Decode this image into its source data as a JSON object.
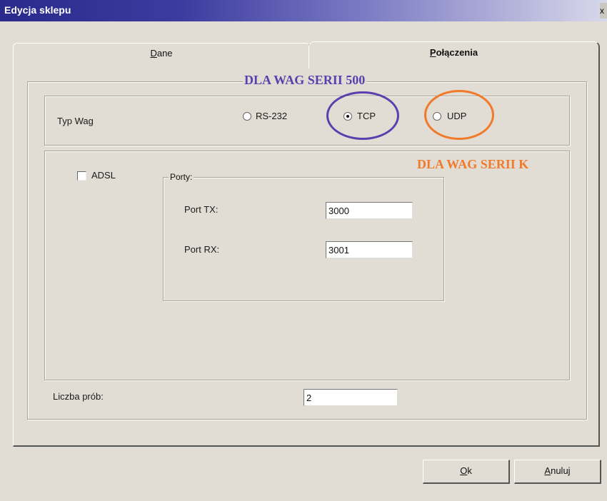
{
  "window": {
    "title": "Edycja sklepu",
    "close_glyph": "x"
  },
  "tabs": [
    {
      "label_first": "D",
      "label_rest": "ane",
      "active": false
    },
    {
      "label_first": "P",
      "label_rest": "ołączenia",
      "active": true
    }
  ],
  "typ_wag": {
    "label": "Typ Wag",
    "options": [
      {
        "label": "RS-232",
        "checked": false
      },
      {
        "label": "TCP",
        "checked": true
      },
      {
        "label": "UDP",
        "checked": false
      }
    ]
  },
  "annotations": {
    "serii_500": {
      "text": "DLA WAG SERII 500",
      "color": "#5b3fae"
    },
    "serii_k": {
      "text": "DLA WAG SERII K",
      "color": "#f07a2a"
    }
  },
  "adsl": {
    "label": "ADSL",
    "checked": false
  },
  "porty": {
    "legend": "Porty:",
    "port_tx_label": "Port TX:",
    "port_tx_value": "3000",
    "port_rx_label": "Port RX:",
    "port_rx_value": "3001"
  },
  "liczba_prob": {
    "label": "Liczba prób:",
    "value": "2"
  },
  "buttons": {
    "ok_first": "O",
    "ok_rest": "k",
    "anuluj_first": "A",
    "anuluj_rest": "nuluj"
  },
  "colors": {
    "title_bar": "#2a2a8c",
    "window_bg": "#e2ddd4",
    "tcp_circle": "#5b3fae",
    "udp_circle": "#f07a2a"
  },
  "icons": [
    "close-icon",
    "radio-icon",
    "checkbox-icon"
  ]
}
